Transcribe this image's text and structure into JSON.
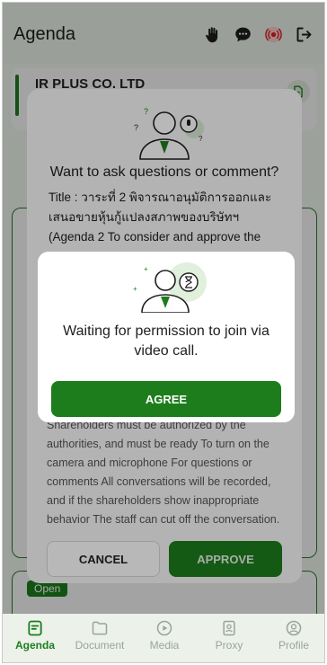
{
  "header": {
    "title": "Agenda"
  },
  "company": {
    "name": "IR PLUS CO. LTD",
    "sub": "ป"
  },
  "status": {
    "open": "Open"
  },
  "question_dialog": {
    "title": "Want to ask questions or comment?",
    "body": "Title : วาระที่ 2 พิจารณาอนุมัติการออกและเสนอขายหุ้นกู้แปลงสภาพของบริษัทฯ (Agenda 2 To consider and approve the",
    "footer": "Shareholders must be authorized by the authorities, and must be ready To turn on the camera and microphone For questions or comments All conversations will be recorded, and if the shareholders show inappropriate behavior The staff can cut off the conversation.",
    "cancel": "CANCEL",
    "approve": "APPROVE"
  },
  "permission_dialog": {
    "text": "Waiting for permission to join via video call.",
    "agree": "AGREE"
  },
  "nav": {
    "items": [
      {
        "label": "Agenda",
        "icon": "agenda-icon"
      },
      {
        "label": "Document",
        "icon": "document-icon"
      },
      {
        "label": "Media",
        "icon": "media-icon"
      },
      {
        "label": "Proxy",
        "icon": "proxy-icon"
      },
      {
        "label": "Profile",
        "icon": "profile-icon"
      }
    ]
  },
  "colors": {
    "brand": "#1d7d1d",
    "background": "#edf3ec"
  }
}
